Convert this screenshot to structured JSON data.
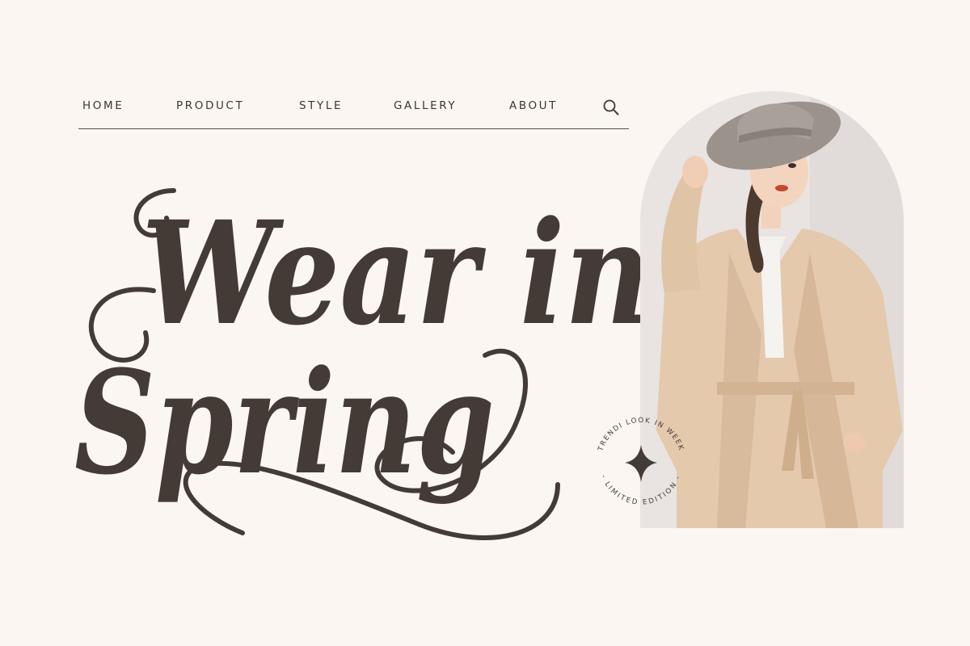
{
  "nav": {
    "items": [
      {
        "label": "HOME"
      },
      {
        "label": "PRODUCT"
      },
      {
        "label": "STYLE"
      },
      {
        "label": "GALLERY"
      },
      {
        "label": "ABOUT"
      }
    ],
    "search_icon": "search-icon"
  },
  "headline": {
    "line1": "Wear in",
    "line2": "Spring"
  },
  "badge": {
    "top_text": "TRENDI LOOK IN WEEK",
    "bottom_text": "- LIMITED EDITION -",
    "icon": "sparkle-icon"
  },
  "colors": {
    "background": "#fbf6f1",
    "text": "#443a36",
    "accent": "#d9c1a6"
  }
}
